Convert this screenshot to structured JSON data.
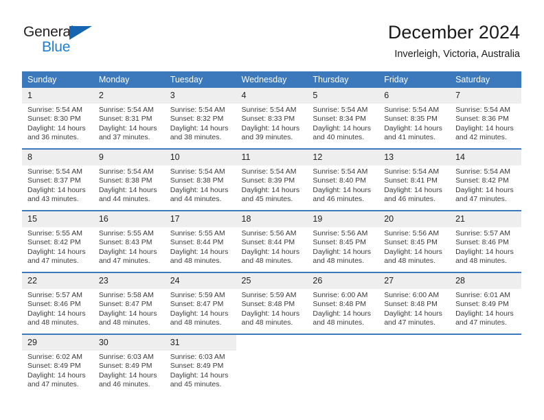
{
  "brand": {
    "name_top": "General",
    "name_bottom": "Blue",
    "accent_color": "#1b7fd4",
    "triangle_color": "#1565b0"
  },
  "header": {
    "title": "December 2024",
    "subtitle": "Inverleigh, Victoria, Australia"
  },
  "theme": {
    "header_row_bg": "#3b79bc",
    "day_number_bg": "#eeeeee",
    "week_divider": "#3b79bc"
  },
  "weekday_headers": [
    "Sunday",
    "Monday",
    "Tuesday",
    "Wednesday",
    "Thursday",
    "Friday",
    "Saturday"
  ],
  "weeks": [
    [
      {
        "day": "1",
        "sunrise": "Sunrise: 5:54 AM",
        "sunset": "Sunset: 8:30 PM",
        "daylight": "Daylight: 14 hours and 36 minutes."
      },
      {
        "day": "2",
        "sunrise": "Sunrise: 5:54 AM",
        "sunset": "Sunset: 8:31 PM",
        "daylight": "Daylight: 14 hours and 37 minutes."
      },
      {
        "day": "3",
        "sunrise": "Sunrise: 5:54 AM",
        "sunset": "Sunset: 8:32 PM",
        "daylight": "Daylight: 14 hours and 38 minutes."
      },
      {
        "day": "4",
        "sunrise": "Sunrise: 5:54 AM",
        "sunset": "Sunset: 8:33 PM",
        "daylight": "Daylight: 14 hours and 39 minutes."
      },
      {
        "day": "5",
        "sunrise": "Sunrise: 5:54 AM",
        "sunset": "Sunset: 8:34 PM",
        "daylight": "Daylight: 14 hours and 40 minutes."
      },
      {
        "day": "6",
        "sunrise": "Sunrise: 5:54 AM",
        "sunset": "Sunset: 8:35 PM",
        "daylight": "Daylight: 14 hours and 41 minutes."
      },
      {
        "day": "7",
        "sunrise": "Sunrise: 5:54 AM",
        "sunset": "Sunset: 8:36 PM",
        "daylight": "Daylight: 14 hours and 42 minutes."
      }
    ],
    [
      {
        "day": "8",
        "sunrise": "Sunrise: 5:54 AM",
        "sunset": "Sunset: 8:37 PM",
        "daylight": "Daylight: 14 hours and 43 minutes."
      },
      {
        "day": "9",
        "sunrise": "Sunrise: 5:54 AM",
        "sunset": "Sunset: 8:38 PM",
        "daylight": "Daylight: 14 hours and 44 minutes."
      },
      {
        "day": "10",
        "sunrise": "Sunrise: 5:54 AM",
        "sunset": "Sunset: 8:38 PM",
        "daylight": "Daylight: 14 hours and 44 minutes."
      },
      {
        "day": "11",
        "sunrise": "Sunrise: 5:54 AM",
        "sunset": "Sunset: 8:39 PM",
        "daylight": "Daylight: 14 hours and 45 minutes."
      },
      {
        "day": "12",
        "sunrise": "Sunrise: 5:54 AM",
        "sunset": "Sunset: 8:40 PM",
        "daylight": "Daylight: 14 hours and 46 minutes."
      },
      {
        "day": "13",
        "sunrise": "Sunrise: 5:54 AM",
        "sunset": "Sunset: 8:41 PM",
        "daylight": "Daylight: 14 hours and 46 minutes."
      },
      {
        "day": "14",
        "sunrise": "Sunrise: 5:54 AM",
        "sunset": "Sunset: 8:42 PM",
        "daylight": "Daylight: 14 hours and 47 minutes."
      }
    ],
    [
      {
        "day": "15",
        "sunrise": "Sunrise: 5:55 AM",
        "sunset": "Sunset: 8:42 PM",
        "daylight": "Daylight: 14 hours and 47 minutes."
      },
      {
        "day": "16",
        "sunrise": "Sunrise: 5:55 AM",
        "sunset": "Sunset: 8:43 PM",
        "daylight": "Daylight: 14 hours and 47 minutes."
      },
      {
        "day": "17",
        "sunrise": "Sunrise: 5:55 AM",
        "sunset": "Sunset: 8:44 PM",
        "daylight": "Daylight: 14 hours and 48 minutes."
      },
      {
        "day": "18",
        "sunrise": "Sunrise: 5:56 AM",
        "sunset": "Sunset: 8:44 PM",
        "daylight": "Daylight: 14 hours and 48 minutes."
      },
      {
        "day": "19",
        "sunrise": "Sunrise: 5:56 AM",
        "sunset": "Sunset: 8:45 PM",
        "daylight": "Daylight: 14 hours and 48 minutes."
      },
      {
        "day": "20",
        "sunrise": "Sunrise: 5:56 AM",
        "sunset": "Sunset: 8:45 PM",
        "daylight": "Daylight: 14 hours and 48 minutes."
      },
      {
        "day": "21",
        "sunrise": "Sunrise: 5:57 AM",
        "sunset": "Sunset: 8:46 PM",
        "daylight": "Daylight: 14 hours and 48 minutes."
      }
    ],
    [
      {
        "day": "22",
        "sunrise": "Sunrise: 5:57 AM",
        "sunset": "Sunset: 8:46 PM",
        "daylight": "Daylight: 14 hours and 48 minutes."
      },
      {
        "day": "23",
        "sunrise": "Sunrise: 5:58 AM",
        "sunset": "Sunset: 8:47 PM",
        "daylight": "Daylight: 14 hours and 48 minutes."
      },
      {
        "day": "24",
        "sunrise": "Sunrise: 5:59 AM",
        "sunset": "Sunset: 8:47 PM",
        "daylight": "Daylight: 14 hours and 48 minutes."
      },
      {
        "day": "25",
        "sunrise": "Sunrise: 5:59 AM",
        "sunset": "Sunset: 8:48 PM",
        "daylight": "Daylight: 14 hours and 48 minutes."
      },
      {
        "day": "26",
        "sunrise": "Sunrise: 6:00 AM",
        "sunset": "Sunset: 8:48 PM",
        "daylight": "Daylight: 14 hours and 48 minutes."
      },
      {
        "day": "27",
        "sunrise": "Sunrise: 6:00 AM",
        "sunset": "Sunset: 8:48 PM",
        "daylight": "Daylight: 14 hours and 47 minutes."
      },
      {
        "day": "28",
        "sunrise": "Sunrise: 6:01 AM",
        "sunset": "Sunset: 8:49 PM",
        "daylight": "Daylight: 14 hours and 47 minutes."
      }
    ],
    [
      {
        "day": "29",
        "sunrise": "Sunrise: 6:02 AM",
        "sunset": "Sunset: 8:49 PM",
        "daylight": "Daylight: 14 hours and 47 minutes."
      },
      {
        "day": "30",
        "sunrise": "Sunrise: 6:03 AM",
        "sunset": "Sunset: 8:49 PM",
        "daylight": "Daylight: 14 hours and 46 minutes."
      },
      {
        "day": "31",
        "sunrise": "Sunrise: 6:03 AM",
        "sunset": "Sunset: 8:49 PM",
        "daylight": "Daylight: 14 hours and 45 minutes."
      },
      {
        "day": "",
        "sunrise": "",
        "sunset": "",
        "daylight": ""
      },
      {
        "day": "",
        "sunrise": "",
        "sunset": "",
        "daylight": ""
      },
      {
        "day": "",
        "sunrise": "",
        "sunset": "",
        "daylight": ""
      },
      {
        "day": "",
        "sunrise": "",
        "sunset": "",
        "daylight": ""
      }
    ]
  ]
}
